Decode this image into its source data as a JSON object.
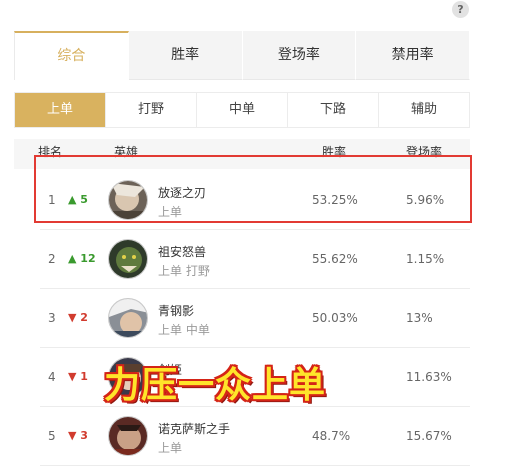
{
  "help_glyph": "?",
  "main_tabs": [
    {
      "label": "综合",
      "active": true
    },
    {
      "label": "胜率",
      "active": false
    },
    {
      "label": "登场率",
      "active": false
    },
    {
      "label": "禁用率",
      "active": false
    }
  ],
  "lanes": [
    {
      "label": "上单",
      "active": true
    },
    {
      "label": "打野",
      "active": false
    },
    {
      "label": "中单",
      "active": false
    },
    {
      "label": "下路",
      "active": false
    },
    {
      "label": "辅助",
      "active": false
    }
  ],
  "columns": {
    "rank": "排名",
    "hero": "英雄",
    "winrate": "胜率",
    "pickrate": "登场率"
  },
  "rows": [
    {
      "rank": "1",
      "trend": "▲ 5",
      "hero": "放逐之刃",
      "lanes": "上单",
      "winrate": "53.25%",
      "pickrate": "5.96%"
    },
    {
      "rank": "2",
      "trend": "▲ 12",
      "hero": "祖安怒兽",
      "lanes": "上单 打野",
      "winrate": "55.62%",
      "pickrate": "1.15%"
    },
    {
      "rank": "3",
      "trend": "▼ 2",
      "hero": "青钢影",
      "lanes": "上单 中单",
      "winrate": "50.03%",
      "pickrate": "13%"
    },
    {
      "rank": "4",
      "trend": "▼ 1",
      "hero": "剑姬",
      "lanes": "",
      "winrate": "%",
      "pickrate": "11.63%"
    },
    {
      "rank": "5",
      "trend": "▼ 3",
      "hero": "诺克萨斯之手",
      "lanes": "上单",
      "winrate": "48.7%",
      "pickrate": "15.67%"
    }
  ],
  "caption": "力压一众上单",
  "colors": {
    "accent": "#d9b25f",
    "up": "#3a9a2e",
    "down": "#d13b2e",
    "highlight": "#e23a33",
    "caption_fill": "#ffe52a",
    "caption_stroke": "#d42417"
  }
}
